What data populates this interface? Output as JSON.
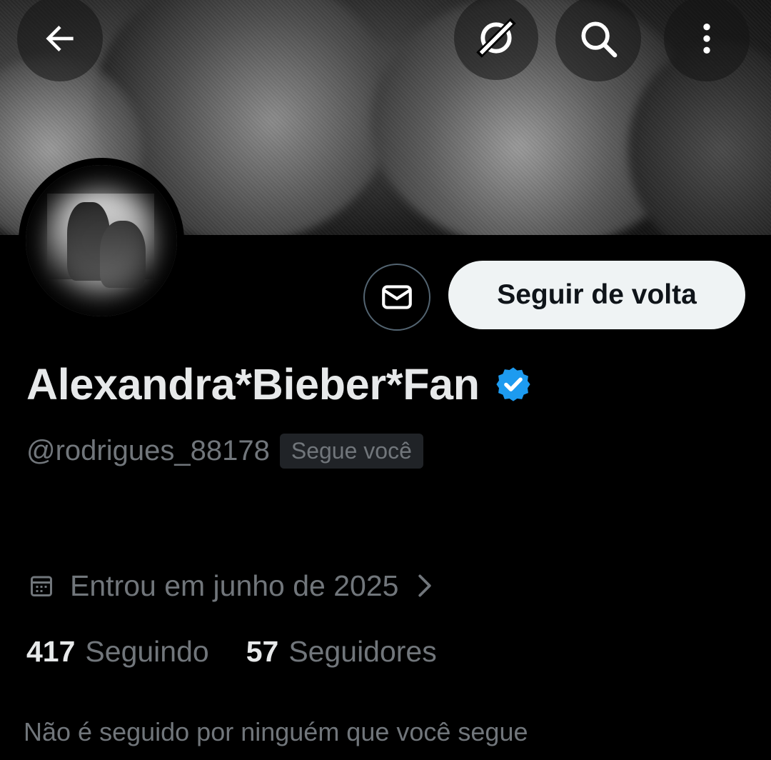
{
  "header": {
    "back_icon": "arrow-left-icon",
    "grok_icon": "grok-icon",
    "search_icon": "search-icon",
    "more_icon": "more-vertical-icon"
  },
  "profile": {
    "display_name": "Alexandra*Bieber*Fan",
    "verified": true,
    "verified_color": "#1d9bf0",
    "handle": "@rodrigues_88178",
    "follows_you_badge": "Segue você",
    "joined": "Entrou em junho de 2025",
    "following_count": "417",
    "following_label": "Seguindo",
    "followers_count": "57",
    "followers_label": "Seguidores",
    "not_followed_text": "Não é seguido por ninguém que você segue"
  },
  "actions": {
    "message_icon": "envelope-icon",
    "follow_back_label": "Seguir de volta"
  },
  "colors": {
    "background": "#000000",
    "primary_text": "#e7e9ea",
    "secondary_text": "#71767b",
    "button_bg": "#eff3f4",
    "button_text": "#0f1419"
  }
}
